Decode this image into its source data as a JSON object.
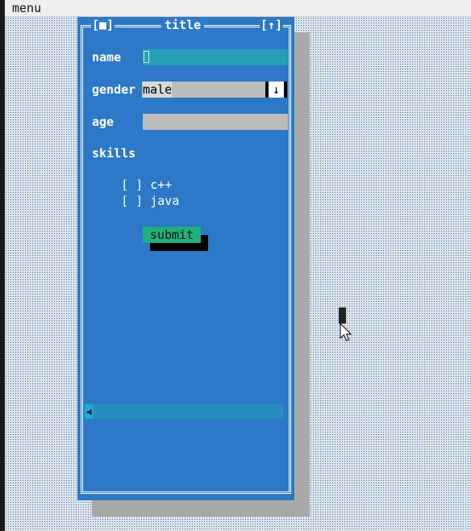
{
  "menubar": {
    "menu_label": "menu"
  },
  "window": {
    "close_label": "[■]",
    "title": "title",
    "maximize_label": "[↑]"
  },
  "form": {
    "name": {
      "label": "name",
      "value": ""
    },
    "gender": {
      "label": "gender",
      "value": "male",
      "arrow": "↓"
    },
    "age": {
      "label": "age",
      "value": ""
    },
    "skills": {
      "label": "skills",
      "options": [
        {
          "box": "[ ]",
          "label": "c++",
          "checked": false
        },
        {
          "box": "[ ]",
          "label": "java",
          "checked": false
        }
      ]
    },
    "submit_label": "submit"
  },
  "scrollbar": {
    "left_arrow": "◀"
  },
  "colors": {
    "desktop": "#dfe6ee",
    "window": "#2d78c8",
    "button": "#1fb07f",
    "input_active": "#2aa8c4",
    "input": "#d8d8d8"
  }
}
